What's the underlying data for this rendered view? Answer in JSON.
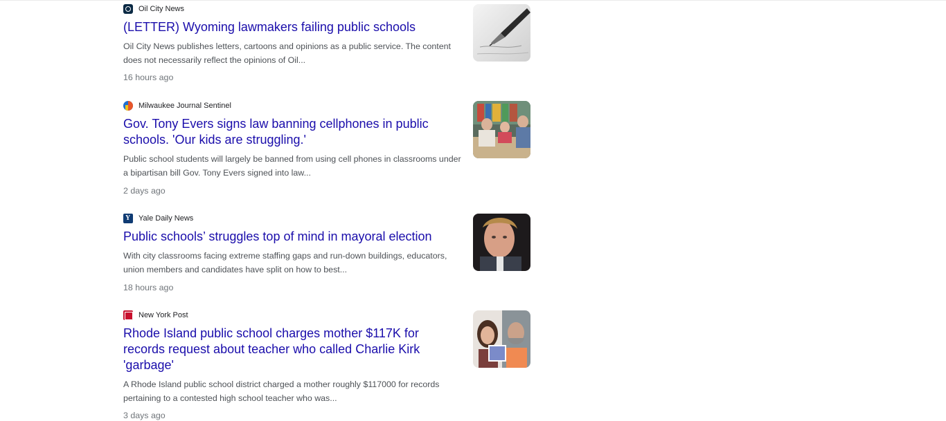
{
  "results": [
    {
      "source": "Oil City News",
      "source_icon": "oil-city-news-logo-icon",
      "title": "(LETTER) Wyoming lawmakers failing public schools",
      "snippet": "Oil City News publishes letters, cartoons and opinions as a public service. The content does not necessarily reflect the opinions of Oil...",
      "age": "16 hours ago",
      "thumbnail": "fountain-pen-writing-image"
    },
    {
      "source": "Milwaukee Journal Sentinel",
      "source_icon": "journal-sentinel-logo-icon",
      "title": "Gov. Tony Evers signs law banning cellphones in public schools. 'Our kids are struggling.'",
      "snippet": "Public school students will largely be banned from using cell phones in classrooms under a bipartisan bill Gov. Tony Evers signed into law...",
      "age": "2 days ago",
      "thumbnail": "classroom-students-image"
    },
    {
      "source": "Yale Daily News",
      "source_icon": "yale-daily-news-logo-icon",
      "title": "Public schools’ struggles top of mind in mayoral election",
      "snippet": "With city classrooms facing extreme staffing gaps and run-down buildings, educators, union members and candidates have split on how to best...",
      "age": "18 hours ago",
      "thumbnail": "man-portrait-image"
    },
    {
      "source": "New York Post",
      "source_icon": "new-york-post-logo-icon",
      "title": "Rhode Island public school charges mother $117K for records request about teacher who called Charlie Kirk 'garbage'",
      "snippet": "A Rhode Island public school district charged a mother roughly $117000 for records pertaining to a contested high school teacher who was...",
      "age": "3 days ago",
      "thumbnail": "mother-and-teacher-split-image"
    }
  ],
  "colors": {
    "link": "#1a0dab",
    "snippet": "#4d5156",
    "age": "#70757a"
  }
}
